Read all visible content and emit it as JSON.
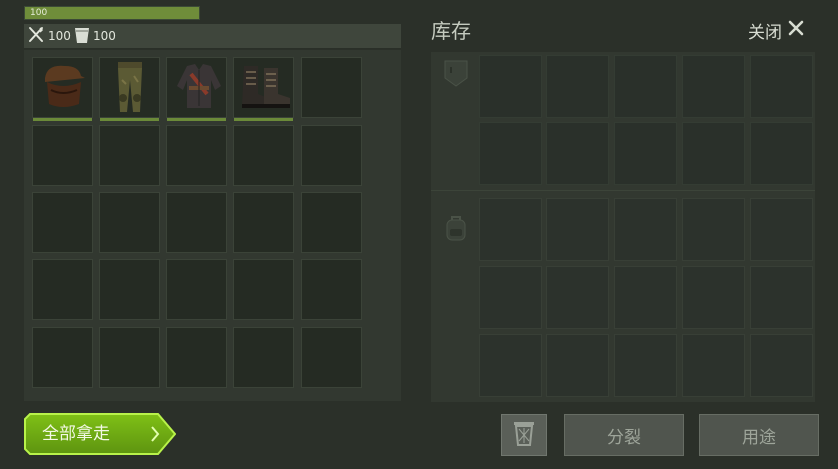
{
  "hud": {
    "health": {
      "value": "100",
      "fill_fraction": 1.0
    },
    "food": "100",
    "water": "100",
    "icons": {
      "food": "crossed-utensils-icon",
      "water": "water-cup-icon"
    }
  },
  "loot": {
    "items": [
      {
        "name": "hood-mask-icon"
      },
      {
        "name": "camo-pants-icon"
      },
      {
        "name": "jacket-icon"
      },
      {
        "name": "boots-icon"
      }
    ]
  },
  "inventory": {
    "title": "库存",
    "close_label": "关闭",
    "close_icon": "close-icon",
    "section_icons": [
      "pocket-icon",
      "backpack-icon"
    ]
  },
  "actions": {
    "take_all": "全部拿走",
    "trash_icon": "trash-icon",
    "split": "分裂",
    "use": "用途"
  },
  "colors": {
    "accent_green": "#8ed41d",
    "health_fill": "#6f8d3a",
    "background": "#2b3029"
  }
}
